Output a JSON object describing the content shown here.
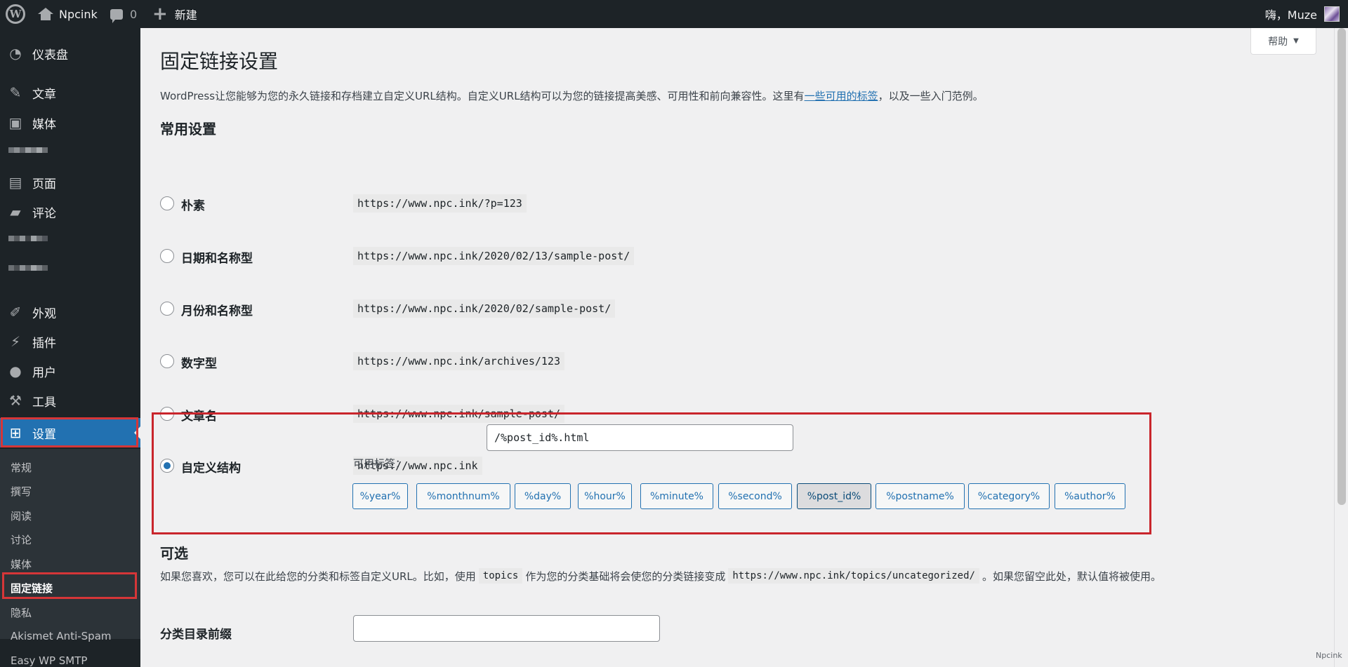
{
  "adminbar": {
    "site_name": "Npcink",
    "comment_count": "0",
    "new_label": "新建",
    "greeting": "嗨，Muze"
  },
  "sidebar": {
    "items": [
      {
        "label": "仪表盘",
        "icon": "dashboard-icon"
      },
      {
        "label": "文章",
        "icon": "pin-icon"
      },
      {
        "label": "媒体",
        "icon": "media-icon"
      },
      {
        "label": "页面",
        "icon": "page-icon"
      },
      {
        "label": "评论",
        "icon": "comment-icon"
      },
      {
        "label": "外观",
        "icon": "brush-icon"
      },
      {
        "label": "插件",
        "icon": "plugin-icon"
      },
      {
        "label": "用户",
        "icon": "user-icon"
      },
      {
        "label": "工具",
        "icon": "wrench-icon"
      },
      {
        "label": "设置",
        "icon": "settings-icon"
      }
    ],
    "submenu": [
      "常规",
      "撰写",
      "阅读",
      "讨论",
      "媒体",
      "固定链接",
      "隐私",
      "Akismet Anti-Spam",
      "Easy WP SMTP"
    ]
  },
  "main": {
    "help_label": "帮助",
    "title": "固定链接设置",
    "intro_before": "WordPress让您能够为您的永久链接和存档建立自定义URL结构。自定义URL结构可以为您的链接提高美感、可用性和前向兼容性。这里有",
    "intro_link": "一些可用的标签",
    "intro_after": "，以及一些入门范例。",
    "common_heading": "常用设置",
    "options": [
      {
        "label": "朴素",
        "example": "https://www.npc.ink/?p=123"
      },
      {
        "label": "日期和名称型",
        "example": "https://www.npc.ink/2020/02/13/sample-post/"
      },
      {
        "label": "月份和名称型",
        "example": "https://www.npc.ink/2020/02/sample-post/"
      },
      {
        "label": "数字型",
        "example": "https://www.npc.ink/archives/123"
      },
      {
        "label": "文章名",
        "example": "https://www.npc.ink/sample-post/"
      }
    ],
    "custom": {
      "label": "自定义结构",
      "base": "https://www.npc.ink",
      "value": "/%post_id%.html",
      "tags_label": "可用标签：",
      "tags": [
        "%year%",
        "%monthnum%",
        "%day%",
        "%hour%",
        "%minute%",
        "%second%",
        "%post_id%",
        "%postname%",
        "%category%",
        "%author%"
      ],
      "active_tag": "%post_id%"
    },
    "optional_heading": "可选",
    "optional_text_1": "如果您喜欢，您可以在此给您的分类和标签自定义URL。比如，使用",
    "optional_code_1": "topics",
    "optional_text_2": "作为您的分类基础将会使您的分类链接变成",
    "optional_code_2": "https://www.npc.ink/topics/uncategorized/",
    "optional_text_3": "。如果您留空此处，默认值将被使用。",
    "category_base_label": "分类目录前缀",
    "watermark": "Npcink"
  }
}
